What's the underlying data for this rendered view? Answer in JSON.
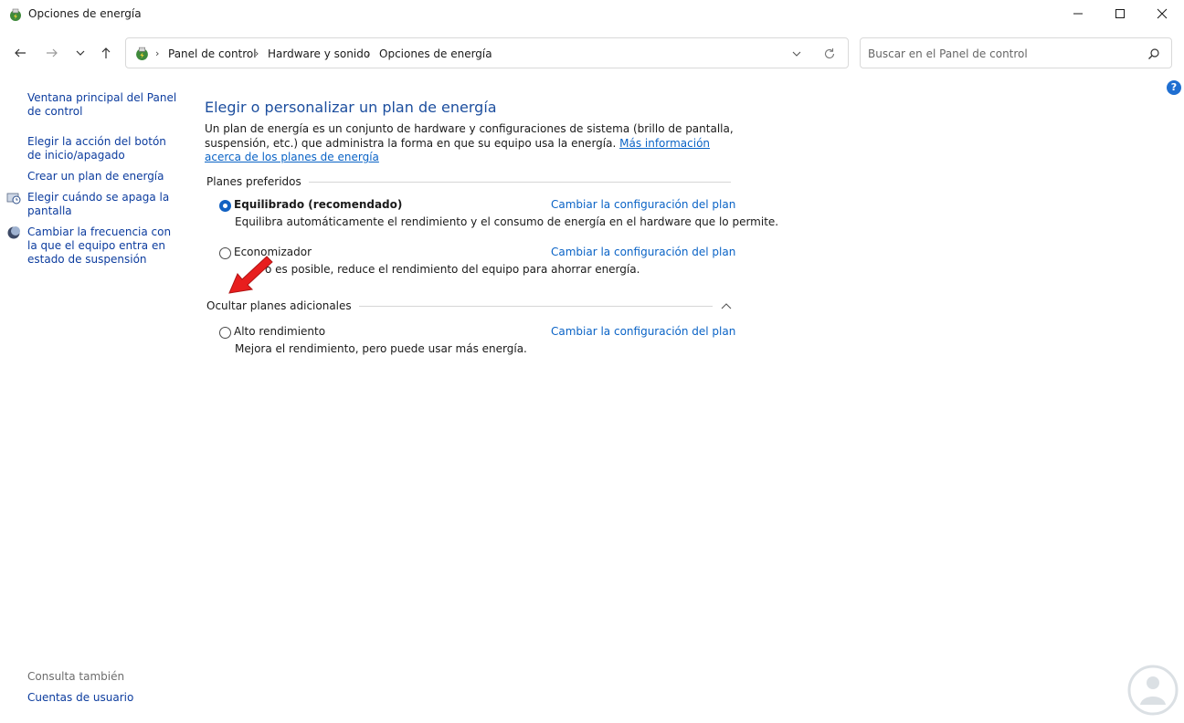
{
  "window": {
    "title": "Opciones de energía",
    "minimize_icon": "minimize-icon",
    "maximize_icon": "maximize-icon",
    "close_icon": "close-icon"
  },
  "nav": {
    "breadcrumbs": [
      "Panel de control",
      "Hardware y sonido",
      "Opciones de energía"
    ],
    "search_placeholder": "Buscar en el Panel de control"
  },
  "sidebar": {
    "links": [
      "Ventana principal del Panel de control",
      "Elegir la acción del botón de inicio/apagado",
      "Crear un plan de energía",
      "Elegir cuándo se apaga la pantalla",
      "Cambiar la frecuencia con la que el equipo entra en estado de suspensión"
    ],
    "see_also": "Consulta también",
    "users_link": "Cuentas de usuario"
  },
  "main": {
    "title": "Elegir o personalizar un plan de energía",
    "intro": "Un plan de energía es un conjunto de hardware y configuraciones de sistema (brillo de pantalla, suspensión, etc.) que administra la forma en que su equipo usa la energía.",
    "intro_link": "Más información acerca de los planes de energía",
    "preferred_title": "Planes preferidos",
    "additional_title": "Ocultar planes adicionales",
    "change_link": "Cambiar la configuración del plan",
    "plans": [
      {
        "name": "Equilibrado (recomendado)",
        "desc": "Equilibra automáticamente el rendimiento y el consumo de energía en el hardware que lo permite.",
        "selected": true
      },
      {
        "name": "Economizador",
        "desc": "Cuando sea posible, reduce el rendimiento del equipo para ahorrar energía.",
        "visible_desc": "o es posible, reduce el rendimiento del equipo para ahorrar energía.",
        "selected": false
      },
      {
        "name": "Alto rendimiento",
        "desc": "Mejora el rendimiento, pero puede usar más energía.",
        "selected": false
      }
    ]
  },
  "colors": {
    "link": "#0a63c6",
    "sidebar_link": "#0c3c9e",
    "title": "#1c4e9e",
    "radio_selected": "#1362c2",
    "annotation_arrow": "#e81e1e"
  }
}
